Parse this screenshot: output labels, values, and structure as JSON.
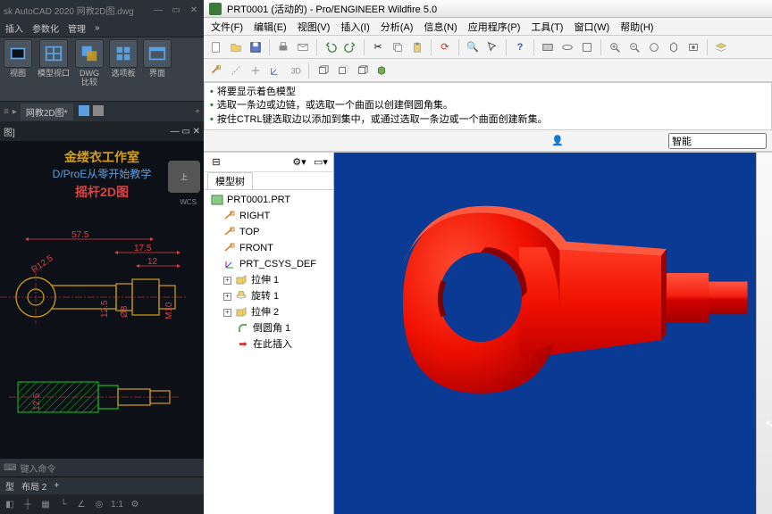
{
  "acad": {
    "title": "sk AutoCAD 2020  网教2D图.dwg",
    "ribbon_tabs": [
      "插入",
      "参数化",
      "管理",
      "»"
    ],
    "ribbon_groups": [
      {
        "label": "视图"
      },
      {
        "label": "模型视口"
      },
      {
        "label": "DWG\n比较"
      },
      {
        "label": "选项板"
      },
      {
        "label": "界面"
      }
    ],
    "doc_tab": "网教2D图*",
    "panel_title": "图]",
    "overlay": {
      "line1": "金缕衣工作室",
      "line2": "D/ProE从零开始教学",
      "line3": "摇杆2D图"
    },
    "viewcube": "上",
    "wcs": "WCS",
    "dims": {
      "w": "57.5",
      "a": "17.5",
      "b": "12",
      "r": "R12.5",
      "h": "12.5",
      "d": "Ø8",
      "m": "M10",
      "side": "12.5"
    },
    "cmd_placeholder": "键入命令",
    "layout_tabs": [
      "型",
      "布局 2"
    ],
    "status": "+"
  },
  "proe": {
    "title": "PRT0001 (活动的) - Pro/ENGINEER Wildfire 5.0",
    "menus": [
      "文件(F)",
      "编辑(E)",
      "视图(V)",
      "插入(I)",
      "分析(A)",
      "信息(N)",
      "应用程序(P)",
      "工具(T)",
      "窗口(W)",
      "帮助(H)"
    ],
    "msgs": [
      "将要显示着色模型",
      "选取一条边或边链，或选取一个曲面以创建倒圆角集。",
      "按住CTRL键选取边以添加到集中，或通过选取一条边或一个曲面创建新集。"
    ],
    "search": "智能",
    "tree_tab": "模型树",
    "tree": [
      {
        "type": "root",
        "label": "PRT0001.PRT"
      },
      {
        "type": "datum",
        "label": "RIGHT"
      },
      {
        "type": "datum",
        "label": "TOP"
      },
      {
        "type": "datum",
        "label": "FRONT"
      },
      {
        "type": "csys",
        "label": "PRT_CSYS_DEF"
      },
      {
        "type": "feat",
        "label": "拉伸 1",
        "exp": "+"
      },
      {
        "type": "feat",
        "label": "旋转 1",
        "exp": "+"
      },
      {
        "type": "feat",
        "label": "拉伸 2",
        "exp": "+"
      },
      {
        "type": "round",
        "label": "倒圆角 1"
      },
      {
        "type": "insert",
        "label": "在此插入"
      }
    ]
  }
}
